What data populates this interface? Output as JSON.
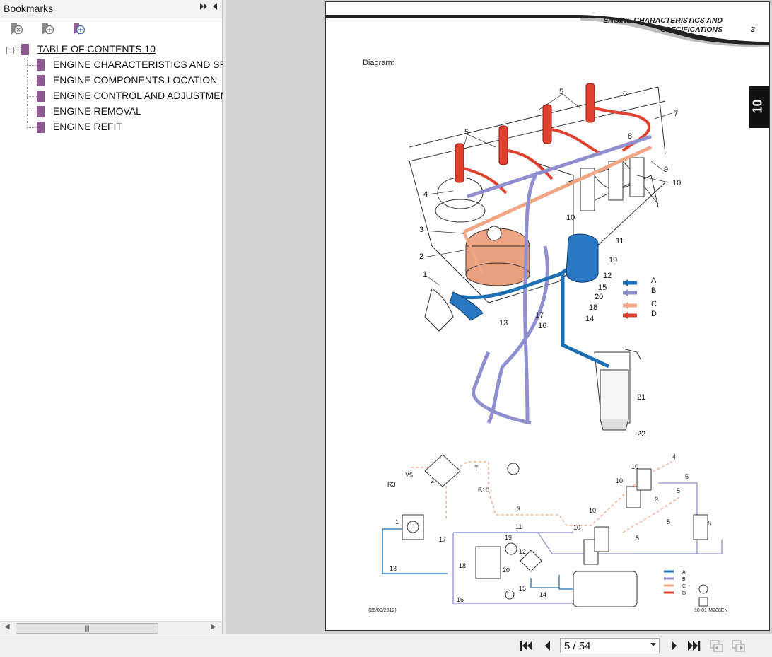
{
  "sidebar": {
    "title": "Bookmarks",
    "toolbar": {
      "delete_icon": "bookmark-delete-icon",
      "add_icon": "bookmark-add-icon",
      "properties_icon": "bookmark-properties-icon"
    },
    "tree": {
      "root": "TABLE OF CONTENTS 10",
      "items": [
        "ENGINE CHARACTERISTICS AND SPECIFICATIONS",
        "ENGINE COMPONENTS LOCATION",
        "ENGINE CONTROL AND ADJUSTMENT",
        "ENGINE REMOVAL",
        "ENGINE REFIT"
      ]
    }
  },
  "document": {
    "header_line1": "ENGINE CHARACTERISTICS AND",
    "header_line2": "SPECIFICATIONS",
    "page_number": "3",
    "section_tab": "10",
    "diagram_label": "Diagram:",
    "footer_left": "(26/09/2012)",
    "footer_right": "10-01-M208EN",
    "callouts_top": [
      "5",
      "6",
      "7",
      "8",
      "9",
      "10",
      "5",
      "4",
      "3",
      "2",
      "1",
      "10",
      "11",
      "19",
      "12",
      "15",
      "20",
      "18",
      "14",
      "17",
      "13",
      "16",
      "21",
      "22"
    ],
    "legend": [
      "A",
      "B",
      "C",
      "D"
    ],
    "callouts_bottom": [
      "R3",
      "Y5",
      "2",
      "B10",
      "T",
      "3",
      "4",
      "10",
      "5",
      "10",
      "5",
      "9",
      "10",
      "5",
      "10",
      "5",
      "8",
      "11",
      "1",
      "17",
      "19",
      "12",
      "18",
      "20",
      "15",
      "14",
      "13",
      "16"
    ],
    "colors": {
      "A": "#1f6fb5",
      "B": "#8f8fd0",
      "C": "#f0a585",
      "D": "#e0402e"
    }
  },
  "navigation": {
    "page_display": "5 / 54"
  }
}
